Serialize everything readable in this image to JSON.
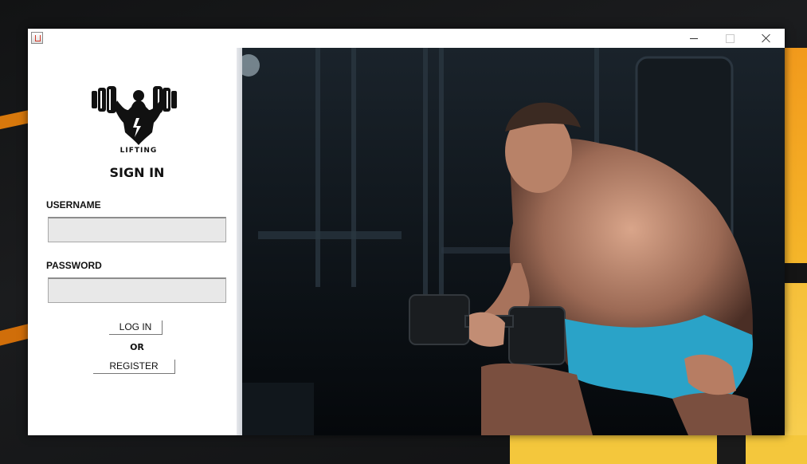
{
  "window": {
    "logo_text": "LIFTING",
    "heading": "SIGN IN",
    "username_label": "USERNAME",
    "username_value": "",
    "password_label": "PASSWORD",
    "password_value": "",
    "login_button": "LOG IN",
    "or_text": "OR",
    "register_button": "REGISTER"
  },
  "titlebar": {
    "icons": [
      "java-app-icon",
      "minimize-icon",
      "maximize-icon",
      "close-icon"
    ]
  },
  "colors": {
    "desktop_accent": "#f08a12",
    "photo_shorts": "#2aa3c8",
    "field_background": "#e8e8e8"
  }
}
